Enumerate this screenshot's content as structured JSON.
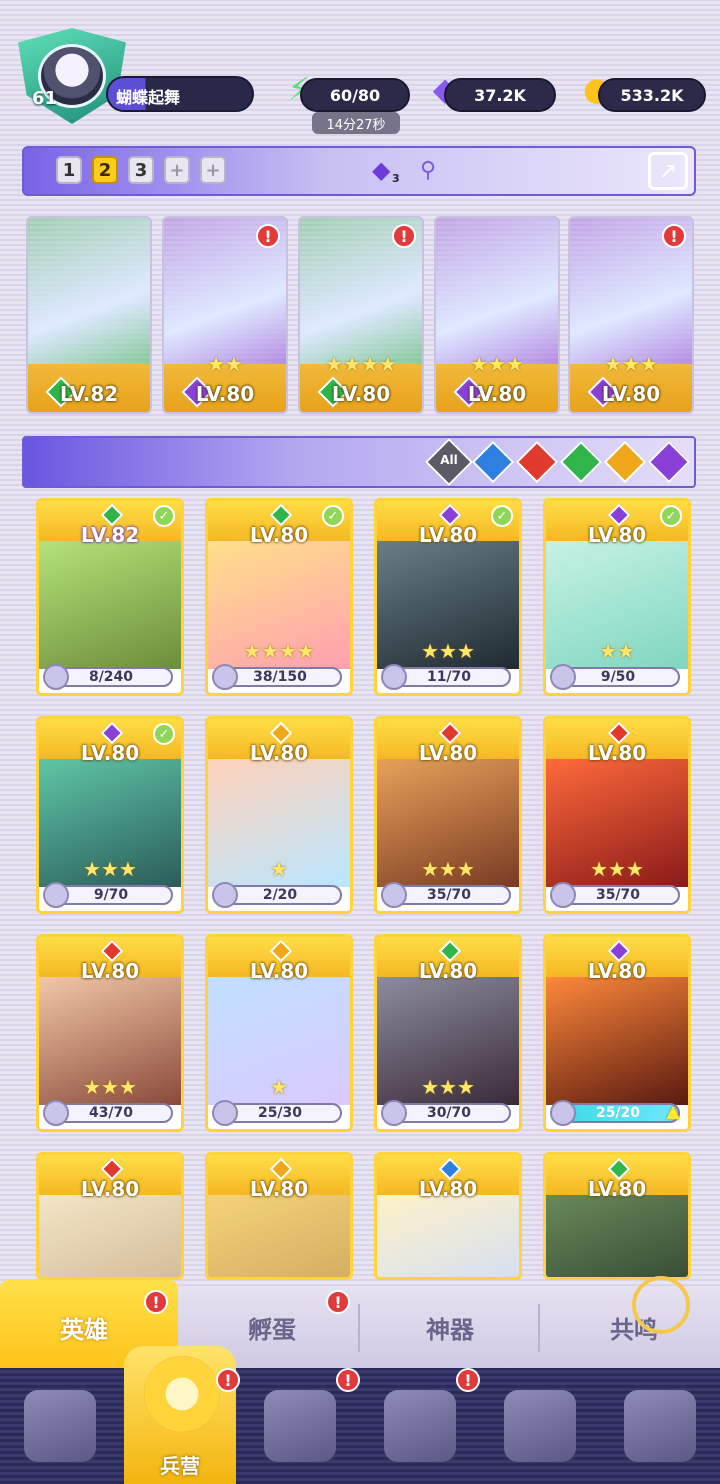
{
  "player": {
    "level": "61",
    "name": "蝴蝶起舞"
  },
  "resources": {
    "stamina": "60/80",
    "stamina_timer": "14分27秒",
    "gems": "37.2K",
    "gold": "533.2K"
  },
  "team_tabs": [
    "1",
    "2",
    "3"
  ],
  "team_gem_count": "3",
  "team_slots": [
    {
      "level": "LV.82",
      "stars": "",
      "element_color": "#2fb54a",
      "alert": false
    },
    {
      "level": "LV.80",
      "stars": "★★",
      "element_color": "#8a3fd6",
      "alert": true
    },
    {
      "level": "LV.80",
      "stars": "★★★★",
      "element_color": "#2fb54a",
      "alert": true
    },
    {
      "level": "LV.80",
      "stars": "★★★",
      "element_color": "#8a3fd6",
      "alert": false
    },
    {
      "level": "LV.80",
      "stars": "★★★",
      "element_color": "#8a3fd6",
      "alert": true
    }
  ],
  "filter": {
    "all_label": "All",
    "elements": [
      "#2f7fe0",
      "#e03a2f",
      "#2fb54a",
      "#f0a81a",
      "#8a3fd6"
    ]
  },
  "heroes": [
    {
      "level": "LV.82",
      "progress": "8/240",
      "stars": "",
      "element": "#2fb54a",
      "check": true,
      "art": [
        "#b6e37a",
        "#6c8d3a"
      ]
    },
    {
      "level": "LV.80",
      "progress": "38/150",
      "stars": "★★★★",
      "element": "#2fb54a",
      "check": true,
      "art": [
        "#ffe18a",
        "#ff9fb0"
      ]
    },
    {
      "level": "LV.80",
      "progress": "11/70",
      "stars": "★★★",
      "element": "#8a3fd6",
      "check": true,
      "art": [
        "#6b7f88",
        "#1f2a32"
      ]
    },
    {
      "level": "LV.80",
      "progress": "9/50",
      "stars": "★★",
      "element": "#8a3fd6",
      "check": true,
      "art": [
        "#c7f2e6",
        "#7fd6c0"
      ]
    },
    {
      "level": "LV.80",
      "progress": "9/70",
      "stars": "★★★",
      "element": "#8a3fd6",
      "check": true,
      "art": [
        "#5fc7a7",
        "#2b5c5a"
      ]
    },
    {
      "level": "LV.80",
      "progress": "2/20",
      "stars": "★",
      "element": "#f0a81a",
      "check": false,
      "art": [
        "#ffd1b8",
        "#b9e6ff"
      ]
    },
    {
      "level": "LV.80",
      "progress": "35/70",
      "stars": "★★★",
      "element": "#e03a2f",
      "check": false,
      "art": [
        "#e8a35a",
        "#7a3a24"
      ]
    },
    {
      "level": "LV.80",
      "progress": "35/70",
      "stars": "★★★",
      "element": "#e03a2f",
      "check": false,
      "art": [
        "#ff6b3b",
        "#8a1a1a"
      ]
    },
    {
      "level": "LV.80",
      "progress": "43/70",
      "stars": "★★★",
      "element": "#e03a2f",
      "check": false,
      "art": [
        "#f2c9a8",
        "#8a4a3a"
      ]
    },
    {
      "level": "LV.80",
      "progress": "25/30",
      "stars": "★",
      "element": "#f0a81a",
      "check": false,
      "art": [
        "#bfe0ff",
        "#d9c9ff"
      ]
    },
    {
      "level": "LV.80",
      "progress": "30/70",
      "stars": "★★★",
      "element": "#2fb54a",
      "check": false,
      "art": [
        "#8e8e9e",
        "#3a2a3a"
      ]
    },
    {
      "level": "LV.80",
      "progress": "25/20",
      "stars": "",
      "element": "#8a3fd6",
      "check": false,
      "full": true,
      "art": [
        "#ff8a3b",
        "#5a1a10"
      ]
    },
    {
      "level": "LV.80",
      "progress": "",
      "stars": "",
      "element": "#e03a2f",
      "check": false,
      "art": [
        "#f4e6c8",
        "#c9b08a"
      ]
    },
    {
      "level": "LV.80",
      "progress": "",
      "stars": "",
      "element": "#f0a81a",
      "check": false,
      "art": [
        "#f6d37a",
        "#c8a25a"
      ]
    },
    {
      "level": "LV.80",
      "progress": "",
      "stars": "",
      "element": "#2f7fe0",
      "check": false,
      "art": [
        "#fff2c8",
        "#c9d9ff"
      ]
    },
    {
      "level": "LV.80",
      "progress": "",
      "stars": "",
      "element": "#2fb54a",
      "check": false,
      "art": [
        "#6a8a5a",
        "#2a3a2a"
      ]
    }
  ],
  "subtabs": [
    "英雄",
    "孵蛋",
    "神器",
    "共鸣"
  ],
  "nav": {
    "active_label": "兵营"
  }
}
